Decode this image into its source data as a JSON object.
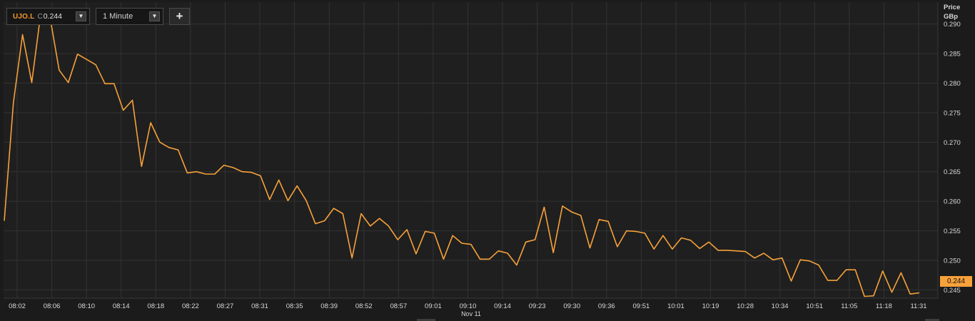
{
  "toolbar": {
    "symbol": "UJO.L",
    "change_prefix": "C",
    "last_value": "0.244",
    "interval": "1 Minute",
    "add_label": "+",
    "dropdown_arrow": "▼"
  },
  "axis": {
    "price_label": "Price",
    "unit_label": "GBp"
  },
  "date_label": "Nov 11",
  "last_price_tag": "0.244",
  "colors": {
    "background": "#1b1b1b",
    "plot_background": "#1f1f1f",
    "grid": "#333333",
    "line": "#f7a13a",
    "text": "#d8d8d8"
  },
  "chart_data": {
    "type": "line",
    "title": "",
    "xlabel": "Nov 11",
    "ylabel": "Price GBp",
    "ylim": [
      0.2436,
      0.2937
    ],
    "grid": true,
    "y_ticks": [
      "0.245",
      "0.250",
      "0.255",
      "0.260",
      "0.265",
      "0.270",
      "0.275",
      "0.280",
      "0.285",
      "0.290"
    ],
    "x_tick_labels": [
      "08:02",
      "08:06",
      "08:10",
      "08:14",
      "08:18",
      "08:22",
      "08:27",
      "08:31",
      "08:35",
      "08:39",
      "08:52",
      "08:57",
      "09:01",
      "09:10",
      "09:14",
      "09:23",
      "09:30",
      "09:36",
      "09:51",
      "10:01",
      "10:19",
      "10:28",
      "10:34",
      "10:51",
      "11:05",
      "11:18",
      "11:31"
    ],
    "series": [
      {
        "values": [
          0.2567,
          0.2767,
          0.2882,
          0.2801,
          0.292,
          0.2911,
          0.2822,
          0.2801,
          0.2849,
          0.284,
          0.2831,
          0.2799,
          0.2799,
          0.2754,
          0.2771,
          0.2659,
          0.2733,
          0.27,
          0.2691,
          0.2687,
          0.2648,
          0.265,
          0.2646,
          0.2646,
          0.2661,
          0.2657,
          0.265,
          0.2649,
          0.2643,
          0.2603,
          0.2636,
          0.2601,
          0.2626,
          0.2601,
          0.2562,
          0.2567,
          0.2588,
          0.2579,
          0.2504,
          0.2579,
          0.2558,
          0.2571,
          0.2558,
          0.2535,
          0.2552,
          0.2511,
          0.2549,
          0.2546,
          0.2502,
          0.2542,
          0.2529,
          0.2527,
          0.2502,
          0.2502,
          0.2516,
          0.2512,
          0.2492,
          0.2531,
          0.2535,
          0.259,
          0.2513,
          0.2592,
          0.2582,
          0.2576,
          0.2521,
          0.2569,
          0.2566,
          0.2523,
          0.255,
          0.2549,
          0.2546,
          0.2519,
          0.2542,
          0.2519,
          0.2538,
          0.2534,
          0.252,
          0.2531,
          0.2517,
          0.2517,
          0.2516,
          0.2515,
          0.2504,
          0.2512,
          0.2501,
          0.2504,
          0.2465,
          0.2501,
          0.2499,
          0.2492,
          0.2466,
          0.2466,
          0.2484,
          0.2484,
          0.2439,
          0.244,
          0.2482,
          0.2446,
          0.2479,
          0.2443,
          0.2445
        ]
      }
    ]
  }
}
